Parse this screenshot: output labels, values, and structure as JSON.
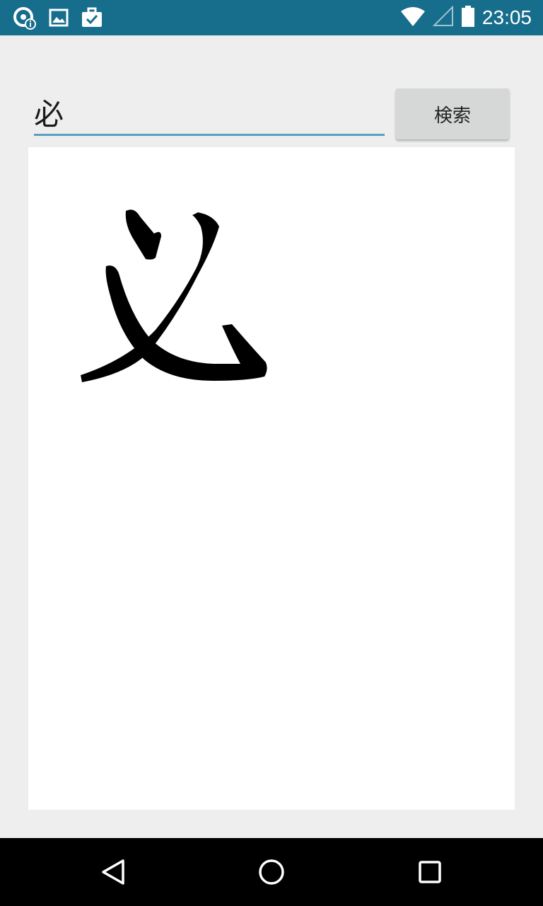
{
  "status_bar": {
    "time": "23:05",
    "left_icons": [
      "sync-info-icon",
      "image-icon",
      "briefcase-check-icon"
    ],
    "right_icons": [
      "wifi-icon",
      "cell-signal-icon",
      "battery-icon"
    ],
    "background_color": "#176d8c"
  },
  "search": {
    "value": "必",
    "button_label": "検索",
    "underline_color": "#5ca0bf"
  },
  "canvas": {
    "background_color": "#ffffff",
    "stroke_color": "#000000"
  },
  "nav_bar": {
    "buttons": [
      "back-icon",
      "home-icon",
      "recents-icon"
    ]
  }
}
